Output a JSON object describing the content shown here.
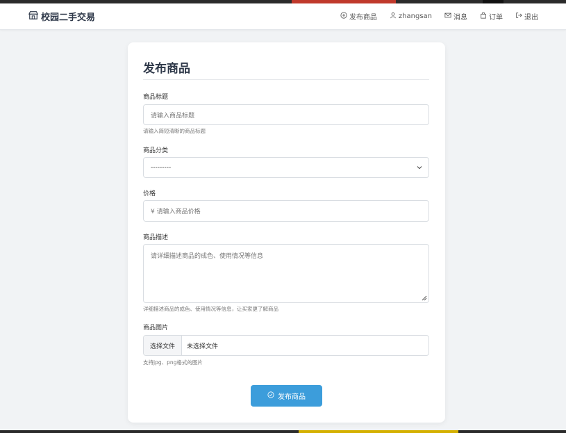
{
  "navbar": {
    "brand": "校园二手交易",
    "items": [
      {
        "label": "发布商品",
        "icon": "plus-circle-icon"
      },
      {
        "label": "zhangsan",
        "icon": "user-icon"
      },
      {
        "label": "消息",
        "icon": "envelope-icon"
      },
      {
        "label": "订单",
        "icon": "bag-icon"
      },
      {
        "label": "退出",
        "icon": "logout-icon"
      }
    ]
  },
  "form": {
    "title": "发布商品",
    "title_field": {
      "label": "商品标题",
      "placeholder": "请输入商品标题",
      "help": "请输入简短清晰的商品标题"
    },
    "category_field": {
      "label": "商品分类",
      "value": "---------"
    },
    "price_field": {
      "label": "价格",
      "placeholder": "¥ 请输入商品价格"
    },
    "description_field": {
      "label": "商品描述",
      "placeholder": "请详细描述商品的成色、使用情况等信息",
      "help": "详细描述商品的成色、使用情况等信息，让买家更了解商品"
    },
    "image_field": {
      "label": "商品图片",
      "button": "选择文件",
      "file_status": "未选择文件",
      "help": "支持jpg、png格式的图片"
    },
    "submit_label": "发布商品"
  },
  "colors": {
    "accent": "#3c9ddb",
    "background": "#f1f3f5",
    "card": "#ffffff"
  }
}
